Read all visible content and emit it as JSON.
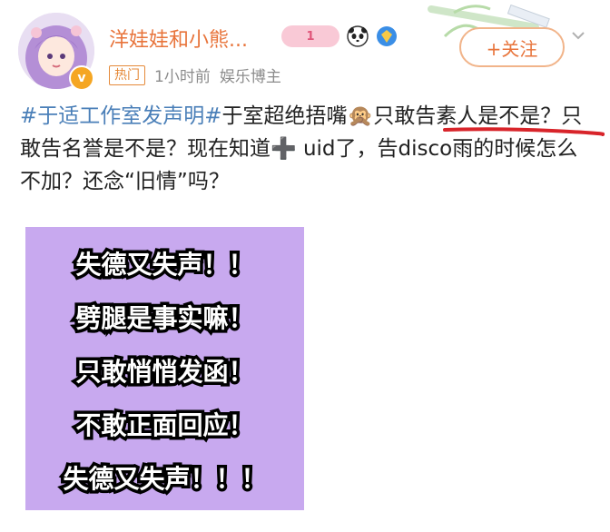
{
  "post": {
    "user": {
      "name": "洋娃娃和小熊...",
      "hot_tag": "热门",
      "time": "1小时前",
      "category": "娱乐博主",
      "follow_label": "+关注",
      "vip_badge_text": "1"
    },
    "body": {
      "hashtag": "#于适工作室发声明#",
      "seg1": "于室超绝捂嘴",
      "emoji": "🙊",
      "highlight": "只敢告素人",
      "seg2": "是不是？只敢告名誉是不是？现在知道",
      "plus": "➕",
      "seg3": " uid了，告disco雨的时候怎么不加？还念“旧情”吗？"
    },
    "image_lines": [
      "失德又失声！！",
      "劈腿是事实嘛！",
      "只敢悄悄发函！",
      "不敢正面回应！",
      "失德又失声！！！"
    ]
  },
  "colors": {
    "username": "#e8743b",
    "hashtag": "#4a7fb8",
    "image_bg": "#c8a9ef",
    "underline": "#d8242a"
  },
  "icons": [
    "avatar",
    "verified-v-icon",
    "vip-badge-icon",
    "panda-icon",
    "diamond-badge-icon",
    "chevron-down-icon"
  ]
}
